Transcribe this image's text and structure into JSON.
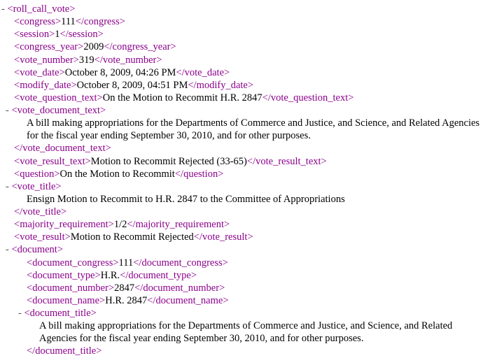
{
  "root_tag": "roll_call_vote",
  "fields": {
    "congress": "111",
    "session": "1",
    "congress_year": "2009",
    "vote_number": "319",
    "vote_date": "October 8, 2009, 04:26 PM",
    "modify_date": "October 8, 2009, 04:51 PM",
    "vote_question_text": "On the Motion to Recommit H.R. 2847",
    "vote_document_text": "A bill making appropriations for the Departments of Commerce and Justice, and Science, and Related Agencies for the fiscal year ending September 30, 2010, and for other purposes.",
    "vote_result_text": "Motion to Recommit Rejected (33-65)",
    "question": "On the Motion to Recommit",
    "vote_title": "Ensign Motion to Recommit to H.R. 2847 to the Committee of Appropriations",
    "majority_requirement": "1/2",
    "vote_result": "Motion to Recommit Rejected"
  },
  "document": {
    "document_congress": "111",
    "document_type": "H.R.",
    "document_number": "2847",
    "document_name": "H.R. 2847",
    "document_title": "A bill making appropriations for the Departments of Commerce and Justice, and Science, and Related Agencies for the fiscal year ending September 30, 2010, and for other purposes."
  },
  "labels": {
    "congress": "congress",
    "session": "session",
    "congress_year": "congress_year",
    "vote_number": "vote_number",
    "vote_date": "vote_date",
    "modify_date": "modify_date",
    "vote_question_text": "vote_question_text",
    "vote_document_text": "vote_document_text",
    "vote_result_text": "vote_result_text",
    "question": "question",
    "vote_title": "vote_title",
    "majority_requirement": "majority_requirement",
    "vote_result": "vote_result",
    "document": "document",
    "document_congress": "document_congress",
    "document_type": "document_type",
    "document_number": "document_number",
    "document_name": "document_name",
    "document_title": "document_title"
  }
}
